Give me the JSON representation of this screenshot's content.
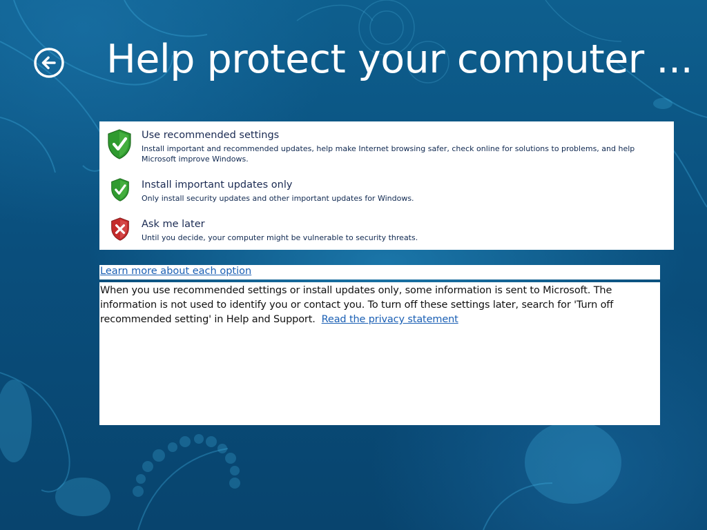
{
  "header": {
    "title": "Help protect your computer ...",
    "back_icon": "back-arrow-icon"
  },
  "options": [
    {
      "title": "Use recommended settings",
      "description": "Install important and recommended updates, help make Internet browsing safer, check online for solutions to problems, and help Microsoft improve Windows.",
      "icon": "green-shield-check-icon"
    },
    {
      "title": "Install important updates only",
      "description": "Only install security updates and other important updates for Windows.",
      "icon": "green-shield-check-icon"
    },
    {
      "title": "Ask me later",
      "description": "Until you decide, your computer might be vulnerable to security threats.",
      "icon": "red-shield-x-icon"
    }
  ],
  "learn_more": {
    "label": "Learn more about each option"
  },
  "info": {
    "text": "When you use recommended settings or install updates only, some information is sent to Microsoft.  The information is not used to identify you or contact you.  To turn off these settings later, search for 'Turn off recommended setting' in Help and Support.",
    "privacy_link": "Read the privacy statement"
  },
  "colors": {
    "background": "#0a4f7d",
    "link": "#1a5fb4",
    "shield_green": "#2f9a2f",
    "shield_red": "#c42b2b"
  }
}
